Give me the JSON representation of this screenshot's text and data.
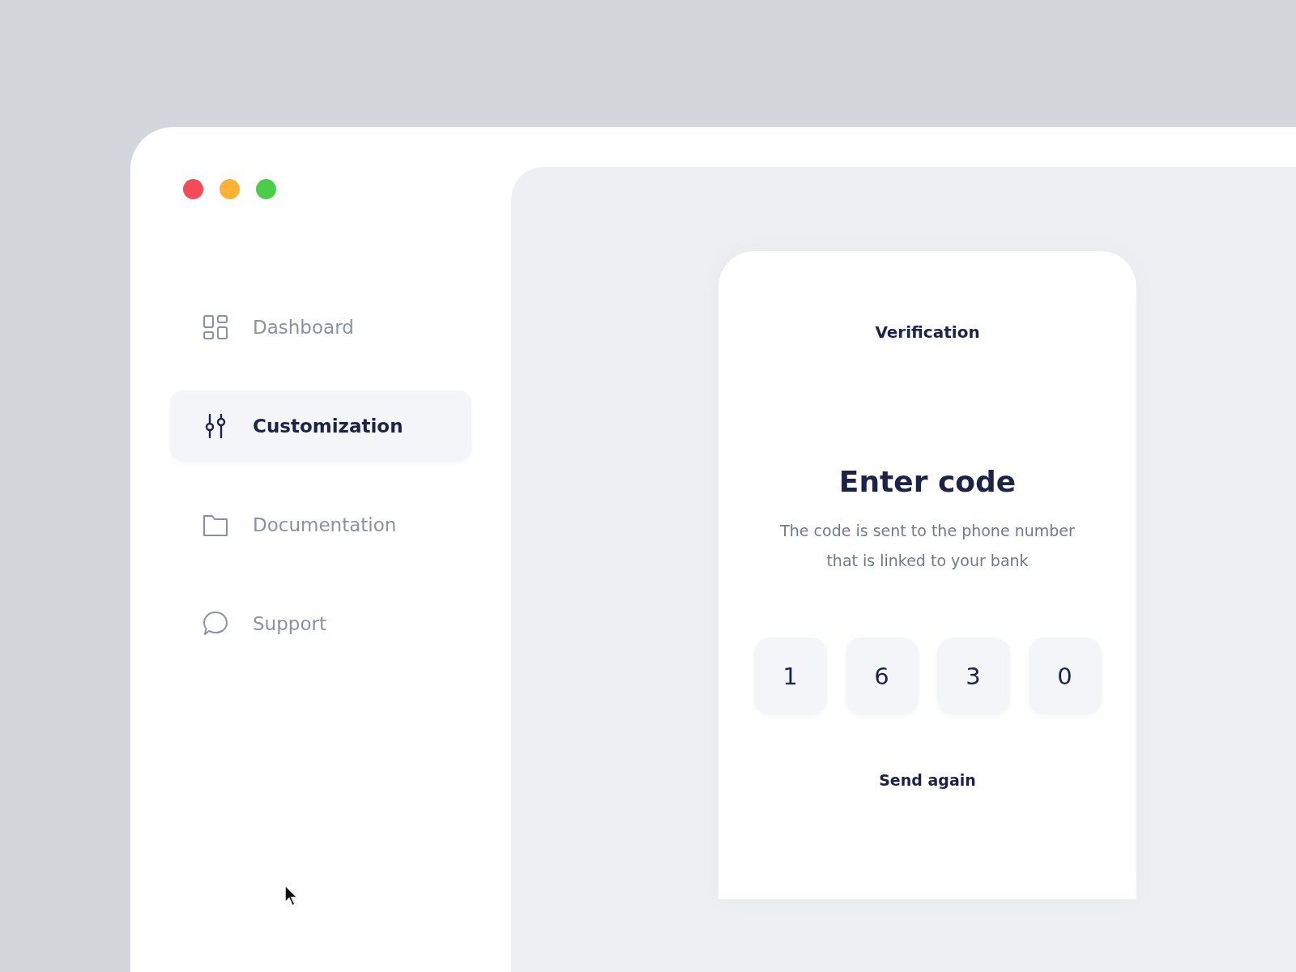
{
  "window": {
    "controls": [
      {
        "color": "#f44b58"
      },
      {
        "color": "#fdb236"
      },
      {
        "color": "#4ccc4a"
      }
    ]
  },
  "sidebar": {
    "items": [
      {
        "label": "Dashboard",
        "kind": "grid",
        "selected": false
      },
      {
        "label": "Customization",
        "kind": "sliders",
        "selected": true
      },
      {
        "label": "Documentation",
        "kind": "folder",
        "selected": false
      },
      {
        "label": "Support",
        "kind": "chat",
        "selected": false
      }
    ]
  },
  "card": {
    "title": "Verification",
    "heading": "Enter code",
    "description": "The code is sent to the phone number that is linked to your bank",
    "code_digits": [
      "1",
      "6",
      "3",
      "0"
    ],
    "link": "Send again"
  }
}
